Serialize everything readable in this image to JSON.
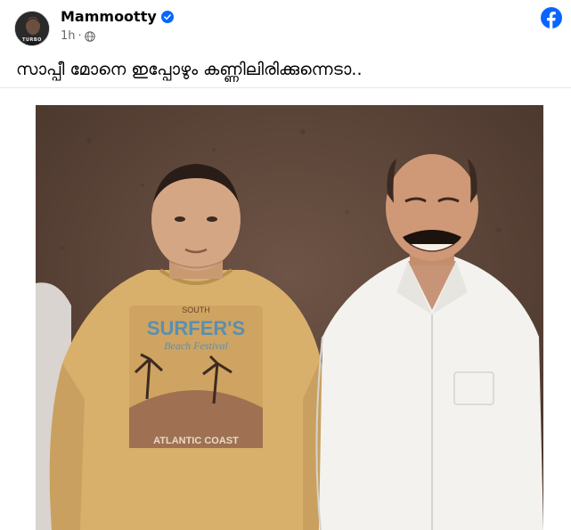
{
  "post": {
    "author": "Mammootty",
    "avatar_text": "TURBO",
    "verified": true,
    "time": "1h",
    "dot": "·",
    "audience_icon": "globe-icon",
    "text": "സാപ്പീ മോനെ ഇപ്പോഴും കണ്ണിലിരിക്കുന്നെടാ..",
    "photo": {
      "shirt_print_lines": [
        "SOUTH",
        "SURFER'S",
        "Beach Festival",
        "ATLANTIC COAST"
      ]
    }
  },
  "brand": {
    "icon": "facebook-logo-icon",
    "color": "#0866ff"
  },
  "colors": {
    "verified": "#0866ff",
    "meta_text": "#65676b"
  }
}
